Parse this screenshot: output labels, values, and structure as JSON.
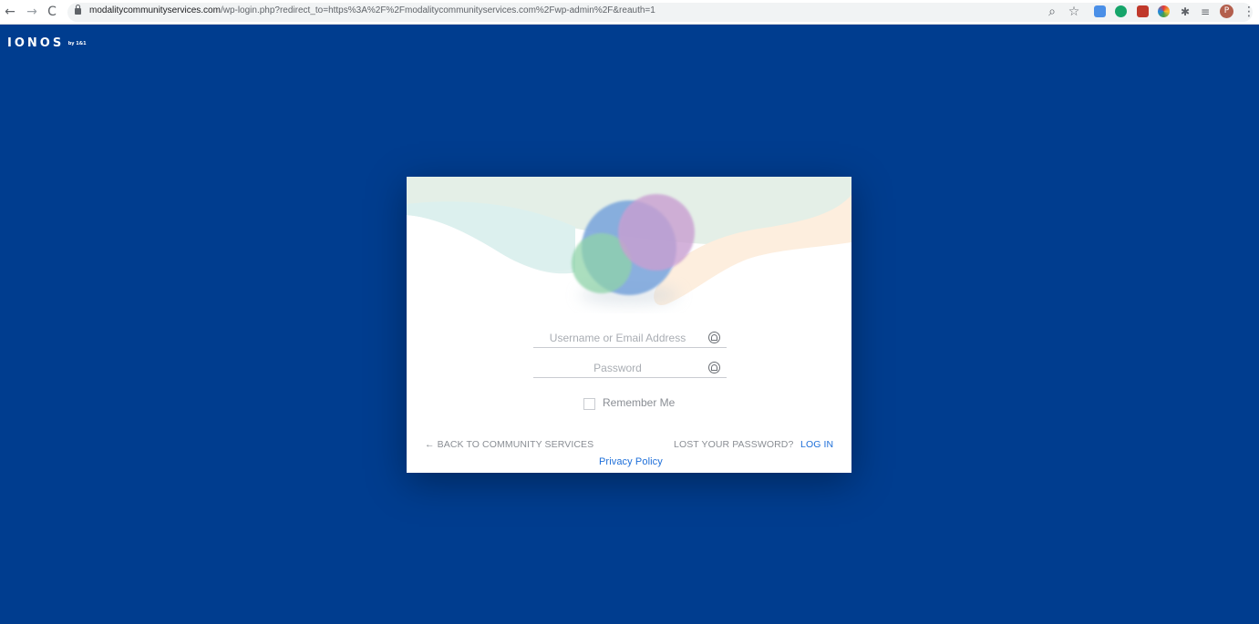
{
  "browser": {
    "back": "←",
    "forward": "→",
    "reload": "C",
    "url_host": "modalitycommunityservices.com",
    "url_path": "/wp-login.php?redirect_to=https%3A%2F%2Fmodalitycommunityservices.com%2Fwp-admin%2F&reauth=1",
    "zoom_icon": "⌕",
    "star_icon": "☆",
    "profile_initial": "P",
    "menu_icon": "⋮"
  },
  "logo": {
    "main": "IONOS",
    "sub": "by 1&1"
  },
  "login": {
    "username_placeholder": "Username or Email Address",
    "password_placeholder": "Password",
    "remember_label": "Remember Me",
    "back_link": "← BACK TO COMMUNITY SERVICES",
    "lost_password": "LOST YOUR PASSWORD?",
    "login_button": "LOG IN",
    "privacy": "Privacy Policy"
  },
  "colors": {
    "page_background": "#003d8f",
    "link_blue": "#1e6fd9",
    "muted_text": "#8a8e94"
  }
}
